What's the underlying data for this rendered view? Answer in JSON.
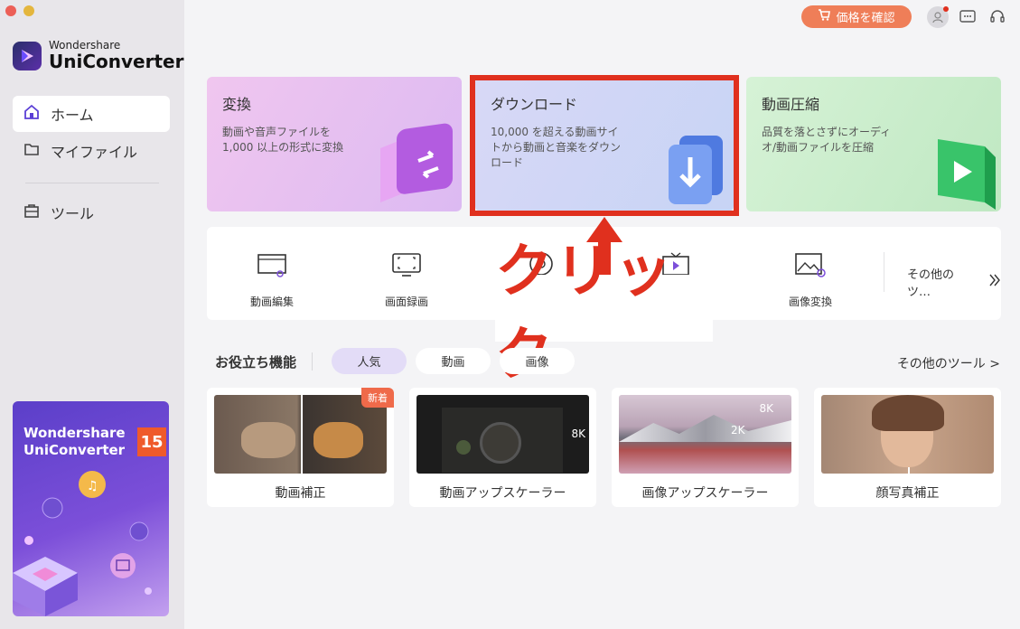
{
  "window": {
    "traffic_lights": [
      "close",
      "minimize"
    ]
  },
  "sidebar": {
    "brand_small": "Wondershare",
    "brand_big": "UniConverter",
    "items": [
      {
        "label": "ホーム",
        "icon": "home-icon",
        "active": true
      },
      {
        "label": "マイファイル",
        "icon": "folder-icon",
        "active": false
      },
      {
        "label": "ツール",
        "icon": "toolbox-icon",
        "active": false
      }
    ],
    "promo": {
      "title_line1": "Wondershare",
      "title_line2": "UniConverter",
      "version_badge": "15"
    }
  },
  "topbar": {
    "price_button": "価格を確認",
    "icons": [
      "user-icon",
      "message-icon",
      "headset-icon"
    ]
  },
  "feature_cards": [
    {
      "title": "変換",
      "desc": "動画や音声ファイルを\n1,000 以上の形式に変換",
      "color": "#e7b7ec"
    },
    {
      "title": "ダウンロード",
      "desc": "10,000 を超える動画サイ\nトから動画と音楽をダウン\nロード",
      "color": "#cdd6f5"
    },
    {
      "title": "動画圧縮",
      "desc": "品質を落とさずにオーディ\nオ/動画ファイルを圧縮",
      "color": "#c7ecc9"
    }
  ],
  "tools": [
    {
      "label": "動画編集",
      "icon": "video-edit-icon"
    },
    {
      "label": "画面録画",
      "icon": "screen-record-icon"
    },
    {
      "label": "",
      "icon": "dvd-burn-icon"
    },
    {
      "label": "",
      "icon": "player-icon"
    },
    {
      "label": "画像変換",
      "icon": "image-convert-icon"
    }
  ],
  "more_tools": "その他のツ…",
  "annotation": {
    "text": "クリック",
    "color": "#e0301e"
  },
  "section": {
    "title": "お役立ち機能",
    "tabs": [
      {
        "label": "人気",
        "active": true
      },
      {
        "label": "動画",
        "active": false
      },
      {
        "label": "画像",
        "active": false
      }
    ],
    "more_link": "その他のツール >"
  },
  "feature_tiles": [
    {
      "label": "動画補正",
      "badge": "新着"
    },
    {
      "label": "動画アップスケーラー",
      "overlay": "8K"
    },
    {
      "label": "画像アップスケーラー",
      "overlay_a": "8K",
      "overlay_b": "2K"
    },
    {
      "label": "顔写真補正"
    }
  ]
}
